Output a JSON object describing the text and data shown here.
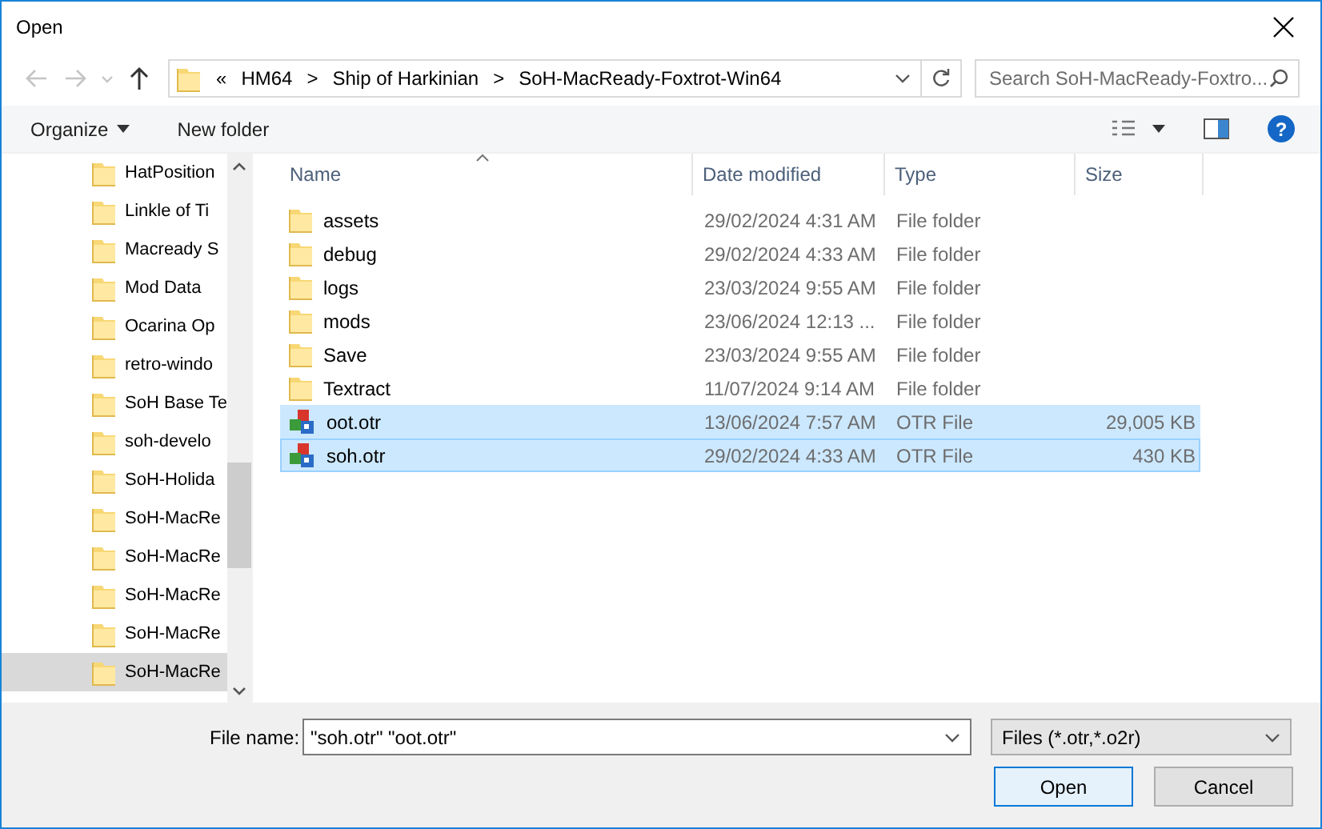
{
  "window": {
    "title": "Open"
  },
  "address": {
    "overflow": "«",
    "crumbs": [
      "HM64",
      "Ship of Harkinian",
      "SoH-MacReady-Foxtrot-Win64"
    ],
    "separator": ">"
  },
  "search": {
    "placeholder": "Search SoH-MacReady-Foxtro..."
  },
  "toolbar": {
    "organize": "Organize",
    "new_folder": "New folder",
    "help": "?"
  },
  "sidebar": {
    "items": [
      {
        "label": "HatPosition",
        "selected": false
      },
      {
        "label": "Linkle of Ti",
        "selected": false
      },
      {
        "label": "Macready S",
        "selected": false
      },
      {
        "label": "Mod Data",
        "selected": false
      },
      {
        "label": "Ocarina Op",
        "selected": false
      },
      {
        "label": "retro-windo",
        "selected": false
      },
      {
        "label": "SoH Base Te",
        "selected": false
      },
      {
        "label": "soh-develo",
        "selected": false
      },
      {
        "label": "SoH-Holida",
        "selected": false
      },
      {
        "label": "SoH-MacRe",
        "selected": false
      },
      {
        "label": "SoH-MacRe",
        "selected": false
      },
      {
        "label": "SoH-MacRe",
        "selected": false
      },
      {
        "label": "SoH-MacRe",
        "selected": false
      },
      {
        "label": "SoH-MacRe",
        "selected": true
      }
    ]
  },
  "table": {
    "columns": [
      "Name",
      "Date modified",
      "Type",
      "Size"
    ],
    "rows": [
      {
        "kind": "folder",
        "name": "assets",
        "date": "29/02/2024 4:31 AM",
        "type": "File folder",
        "selected": false
      },
      {
        "kind": "folder",
        "name": "debug",
        "date": "29/02/2024 4:33 AM",
        "type": "File folder",
        "selected": false
      },
      {
        "kind": "folder",
        "name": "logs",
        "date": "23/03/2024 9:55 AM",
        "type": "File folder",
        "selected": false
      },
      {
        "kind": "folder",
        "name": "mods",
        "date": "23/06/2024 12:13 ...",
        "type": "File folder",
        "selected": false
      },
      {
        "kind": "folder",
        "name": "Save",
        "date": "23/03/2024 9:55 AM",
        "type": "File folder",
        "selected": false
      },
      {
        "kind": "folder",
        "name": "Textract",
        "date": "11/07/2024 9:14 AM",
        "type": "File folder",
        "selected": false
      },
      {
        "kind": "file",
        "name": "oot.otr",
        "date": "13/06/2024 7:57 AM",
        "type": "OTR File",
        "size": "29,005 KB",
        "selected": true
      },
      {
        "kind": "file",
        "name": "soh.otr",
        "date": "29/02/2024 4:33 AM",
        "type": "OTR File",
        "size": "430 KB",
        "selected": true
      }
    ]
  },
  "file_name": {
    "label": "File name:",
    "value": "\"soh.otr\" \"oot.otr\""
  },
  "filter": {
    "value": "Files (*.otr,*.o2r)"
  },
  "buttons": [
    "Open",
    "Cancel"
  ]
}
